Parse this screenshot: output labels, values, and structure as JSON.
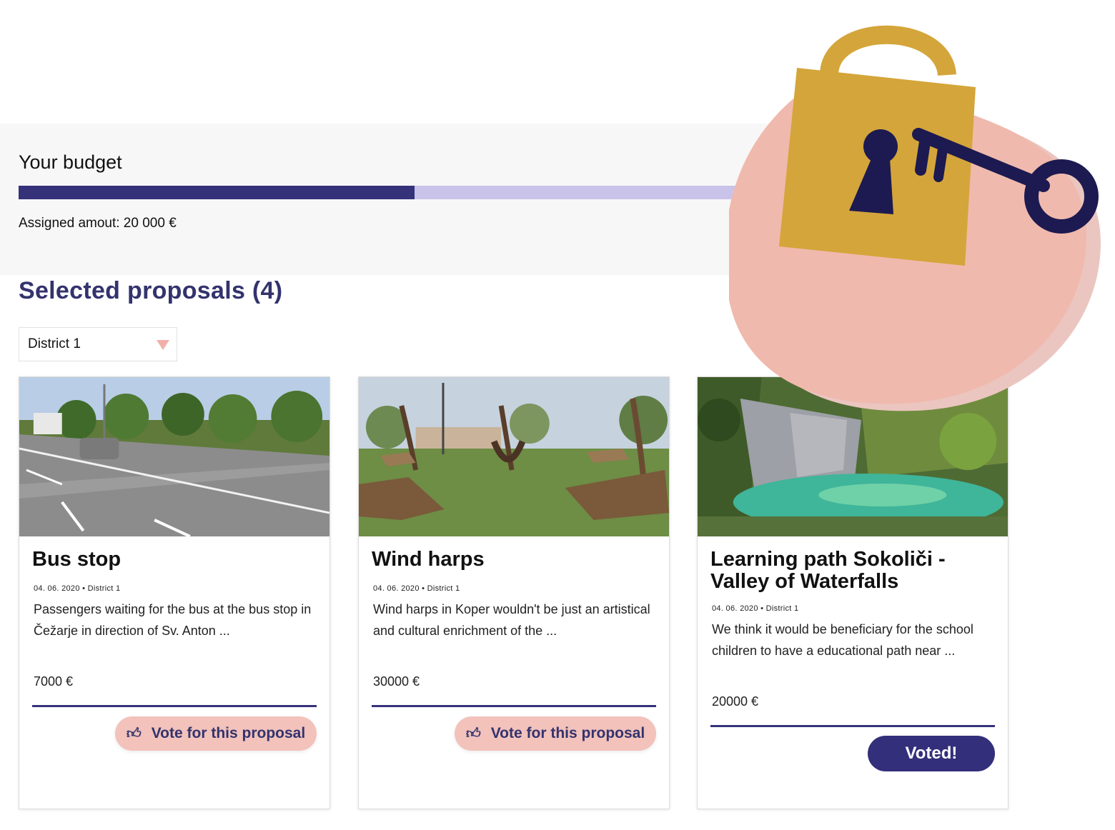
{
  "budget": {
    "title": "Your budget",
    "spent_fraction": 0.523,
    "assigned_label": "Assigned amout: 20 000 €"
  },
  "section": {
    "title": "Selected proposals (4)"
  },
  "filter": {
    "selected": "District 1"
  },
  "proposals": [
    {
      "title": "Bus stop",
      "meta": "04. 06. 2020 • District 1",
      "description": "Passengers waiting for the bus at the bus stop in Čežarje in direction of Sv. Anton ...",
      "price": "7000 €",
      "button": "Vote for this proposal",
      "voted": false
    },
    {
      "title": "Wind harps",
      "meta": "04. 06. 2020 • District 1",
      "description": "Wind harps in Koper wouldn't be just an artistical and cultural enrichment of the ...",
      "price": "30000 €",
      "button": "Vote for this proposal",
      "voted": false
    },
    {
      "title": "Learning path Sokoliči - Valley of Waterfalls",
      "meta": "04. 06. 2020 • District 1",
      "description": "We think it would be beneficiary for the school children to have a educational path near ...",
      "price": "20000 €",
      "button": "Voted!",
      "voted": true
    }
  ],
  "colors": {
    "primary": "#35327a",
    "bar_track": "#c9c3ea",
    "vote_button": "#f2c2bb",
    "lock_gold": "#d4a53a",
    "blob_pink": "#f0b9ad"
  },
  "icons": {
    "lock": "padlock-icon",
    "key": "key-icon",
    "thumb": "thumbs-up-icon",
    "dropdown": "chevron-down-icon"
  }
}
